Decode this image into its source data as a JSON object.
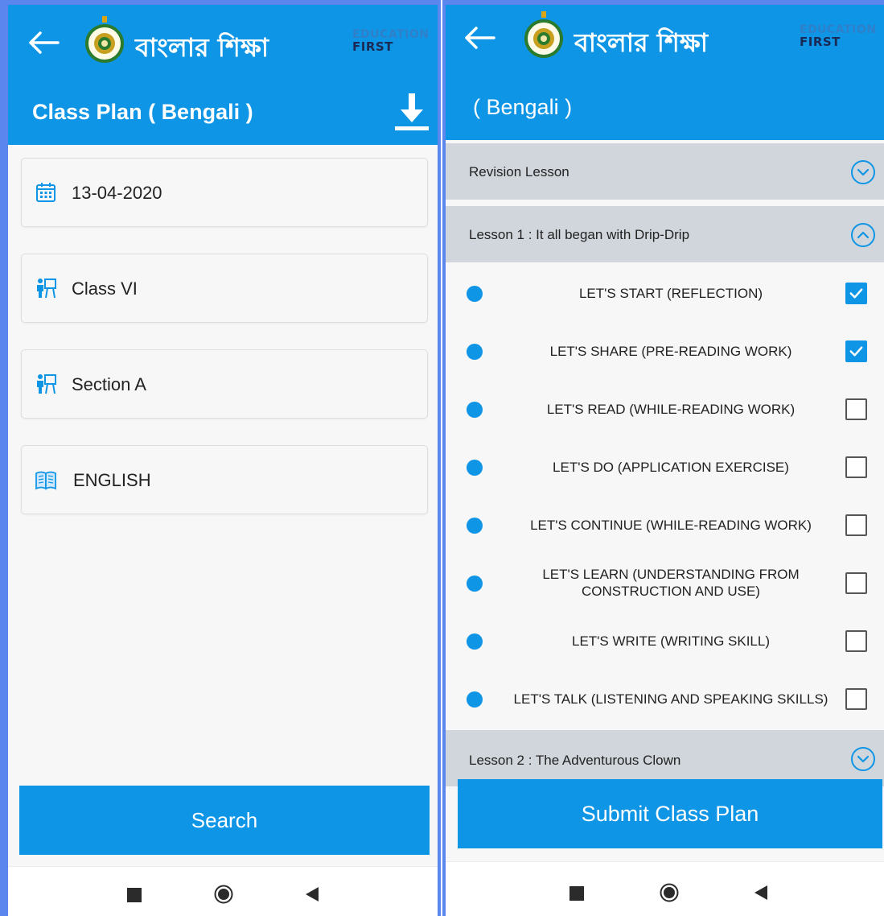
{
  "app": {
    "title": "বাংলার শিক্ষা",
    "brand_line1": "EDUCATION",
    "brand_line2": "FIRST"
  },
  "left_screen": {
    "page_title": "Class Plan ( Bengali )",
    "fields": [
      {
        "icon": "calendar-icon",
        "value": "13-04-2020"
      },
      {
        "icon": "classroom-icon",
        "value": "Class VI"
      },
      {
        "icon": "classroom-icon",
        "value": "Section A"
      },
      {
        "icon": "book-icon",
        "value": "ENGLISH"
      }
    ],
    "search_label": "Search"
  },
  "right_screen": {
    "page_title": "( Bengali )",
    "sections": [
      {
        "label": "Revision Lesson",
        "expanded": false
      },
      {
        "label": "Lesson 1 : It all began with Drip-Drip",
        "expanded": true
      },
      {
        "label": "Lesson 2 : The Adventurous Clown",
        "expanded": false
      }
    ],
    "steps": [
      {
        "label": "LET'S START (REFLECTION)",
        "checked": true
      },
      {
        "label": "LET'S SHARE (PRE-READING WORK)",
        "checked": true
      },
      {
        "label": "LET'S READ (WHILE-READING WORK)",
        "checked": false
      },
      {
        "label": "LET'S DO (APPLICATION EXERCISE)",
        "checked": false
      },
      {
        "label": "LET'S CONTINUE (WHILE-READING WORK)",
        "checked": false
      },
      {
        "label": "LET'S LEARN (UNDERSTANDING FROM CONSTRUCTION AND USE)",
        "checked": false
      },
      {
        "label": "LET'S WRITE (WRITING SKILL)",
        "checked": false
      },
      {
        "label": "LET'S TALK (LISTENING AND SPEAKING SKILLS)",
        "checked": false
      }
    ],
    "submit_label": "Submit Class Plan"
  },
  "colors": {
    "primary": "#0f95e6",
    "accordion_bg": "#d0d6dc",
    "page_bg": "#f7f7f7",
    "frame": "#5b86ee"
  },
  "nav_icons": [
    "recents-icon",
    "home-icon",
    "back-triangle-icon"
  ]
}
